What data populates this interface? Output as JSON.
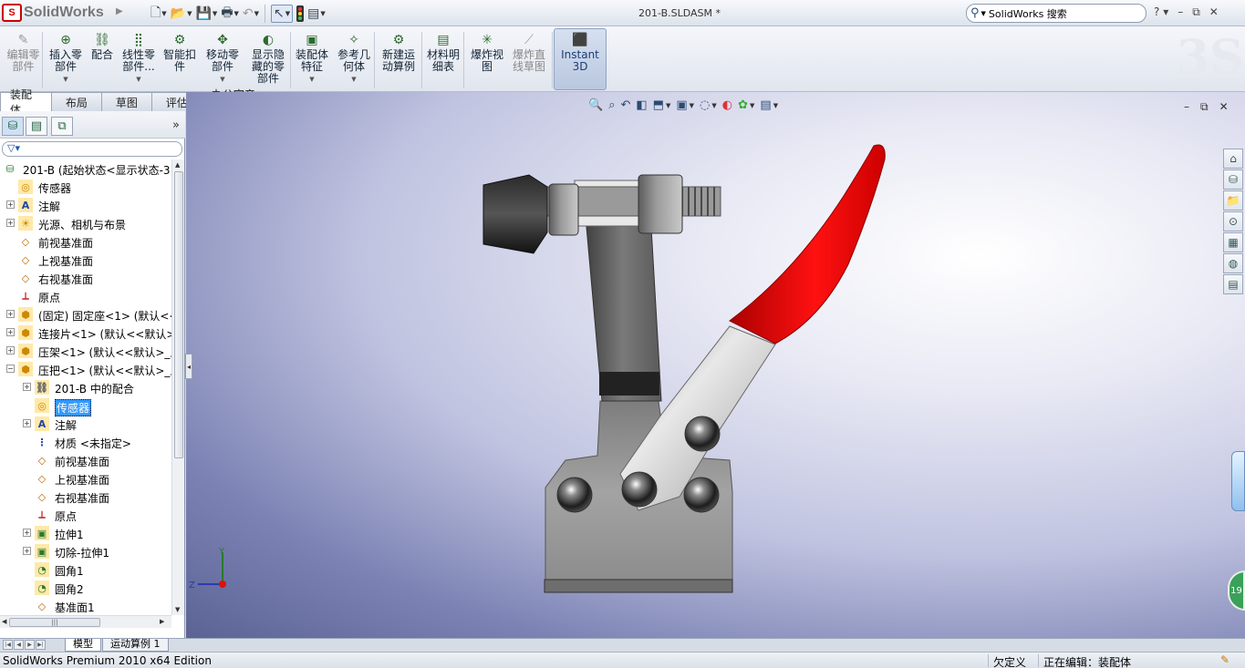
{
  "app": {
    "logo_text": "SolidWorks",
    "document_title": "201-B.SLDASM *",
    "search_placeholder": "SolidWorks 搜索",
    "help": "?",
    "colors": {
      "accent": "#3399ff",
      "brand_red": "#cc0000",
      "handle_red": "#e00000"
    }
  },
  "quick_access": [
    {
      "icon": "new-document-icon"
    },
    {
      "icon": "open-folder-icon"
    },
    {
      "icon": "save-icon"
    },
    {
      "icon": "print-icon"
    },
    {
      "icon": "undo-icon"
    },
    {
      "icon": "select-arrow-icon"
    },
    {
      "icon": "rebuild-traffic-light-icon"
    },
    {
      "icon": "options-icon"
    }
  ],
  "ribbon": {
    "buttons": [
      {
        "id": "edit-component",
        "label": "编辑零部件",
        "icon": "edit-component-icon",
        "enabled": false
      },
      {
        "id": "insert-component",
        "label": "插入零部件",
        "icon": "insert-component-icon",
        "enabled": true
      },
      {
        "id": "mate",
        "label": "配合",
        "icon": "mate-icon",
        "enabled": true
      },
      {
        "id": "linear-pattern",
        "label": "线性零部件...",
        "icon": "linear-pattern-icon",
        "enabled": true
      },
      {
        "id": "smart-fasteners",
        "label": "智能扣件",
        "icon": "smart-fasteners-icon",
        "enabled": true
      },
      {
        "id": "move-component",
        "label": "移动零部件",
        "icon": "move-component-icon",
        "enabled": true
      },
      {
        "id": "show-hidden",
        "label": "显示隐藏的零部件",
        "icon": "show-hidden-icon",
        "enabled": true
      },
      {
        "id": "assembly-features",
        "label": "装配体特征",
        "icon": "assembly-features-icon",
        "enabled": true
      },
      {
        "id": "reference-geometry",
        "label": "参考几何体",
        "icon": "reference-geometry-icon",
        "enabled": true
      },
      {
        "id": "new-motion-study",
        "label": "新建运动算例",
        "icon": "motion-study-icon",
        "enabled": true
      },
      {
        "id": "bom",
        "label": "材料明细表",
        "icon": "bom-icon",
        "enabled": true
      },
      {
        "id": "exploded-view",
        "label": "爆炸视图",
        "icon": "exploded-view-icon",
        "enabled": true
      },
      {
        "id": "explode-line-sketch",
        "label": "爆炸直线草图",
        "icon": "explode-line-icon",
        "enabled": false
      },
      {
        "id": "instant3d",
        "label": "Instant3D",
        "icon": "instant3d-icon",
        "enabled": true,
        "active": true
      }
    ]
  },
  "command_tabs": [
    {
      "label": "装配体",
      "active": true
    },
    {
      "label": "布局",
      "active": false
    },
    {
      "label": "草图",
      "active": false
    },
    {
      "label": "评估",
      "active": false
    },
    {
      "label": "办公室产品",
      "active": false
    }
  ],
  "feature_tree": {
    "tabs": [
      {
        "icon": "featuremanager-icon"
      },
      {
        "icon": "propertymanager-icon"
      },
      {
        "icon": "configurationmanager-icon"
      }
    ],
    "more": "»",
    "items": [
      {
        "label": "201-B  (起始状态<显示状态-3",
        "icon": "assembly-icon",
        "level": 0,
        "expander": false
      },
      {
        "label": "传感器",
        "icon": "sensor-icon",
        "level": 1,
        "expander": false
      },
      {
        "label": "注解",
        "icon": "annotation-icon",
        "level": 1,
        "expander": true
      },
      {
        "label": "光源、相机与布景",
        "icon": "lights-icon",
        "level": 1,
        "expander": true
      },
      {
        "label": "前视基准面",
        "icon": "plane-icon",
        "level": 1,
        "expander": false
      },
      {
        "label": "上视基准面",
        "icon": "plane-icon",
        "level": 1,
        "expander": false
      },
      {
        "label": "右视基准面",
        "icon": "plane-icon",
        "level": 1,
        "expander": false
      },
      {
        "label": "原点",
        "icon": "origin-icon",
        "level": 1,
        "expander": false
      },
      {
        "label": "(固定) 固定座<1> (默认<<默",
        "icon": "part-icon",
        "level": 1,
        "expander": true
      },
      {
        "label": "连接片<1> (默认<<默认>",
        "icon": "part-icon",
        "level": 1,
        "expander": true
      },
      {
        "label": "压架<1> (默认<<默认>_显",
        "icon": "part-icon",
        "level": 1,
        "expander": true
      },
      {
        "label": "压把<1> (默认<<默认>_显",
        "icon": "part-icon",
        "level": 1,
        "expander": "open"
      },
      {
        "label": "201-B 中的配合",
        "icon": "mates-folder-icon",
        "level": 2,
        "expander": true
      },
      {
        "label": "传感器",
        "icon": "sensor-icon",
        "level": 2,
        "expander": false,
        "selected": true
      },
      {
        "label": "注解",
        "icon": "annotation-icon",
        "level": 2,
        "expander": true
      },
      {
        "label": "材质 <未指定>",
        "icon": "material-icon",
        "level": 2,
        "expander": false
      },
      {
        "label": "前视基准面",
        "icon": "plane-icon",
        "level": 2,
        "expander": false
      },
      {
        "label": "上视基准面",
        "icon": "plane-icon",
        "level": 2,
        "expander": false
      },
      {
        "label": "右视基准面",
        "icon": "plane-icon",
        "level": 2,
        "expander": false
      },
      {
        "label": "原点",
        "icon": "origin-icon",
        "level": 2,
        "expander": false
      },
      {
        "label": "拉伸1",
        "icon": "extrude-icon",
        "level": 2,
        "expander": true
      },
      {
        "label": "切除-拉伸1",
        "icon": "cut-extrude-icon",
        "level": 2,
        "expander": true
      },
      {
        "label": "圆角1",
        "icon": "fillet-icon",
        "level": 2,
        "expander": false
      },
      {
        "label": "圆角2",
        "icon": "fillet-icon",
        "level": 2,
        "expander": false
      },
      {
        "label": "基准面1",
        "icon": "plane-icon",
        "level": 2,
        "expander": false
      }
    ]
  },
  "bottom_tabs": [
    {
      "label": "模型",
      "active": true
    },
    {
      "label": "运动算例 1",
      "active": false
    }
  ],
  "status_bar": {
    "product": "SolidWorks Premium 2010 x64 Edition",
    "units": "欠定义",
    "mode": "正在编辑：装配体"
  },
  "triad": {
    "y": "Y",
    "z": "Z"
  },
  "motion_badge": "19"
}
